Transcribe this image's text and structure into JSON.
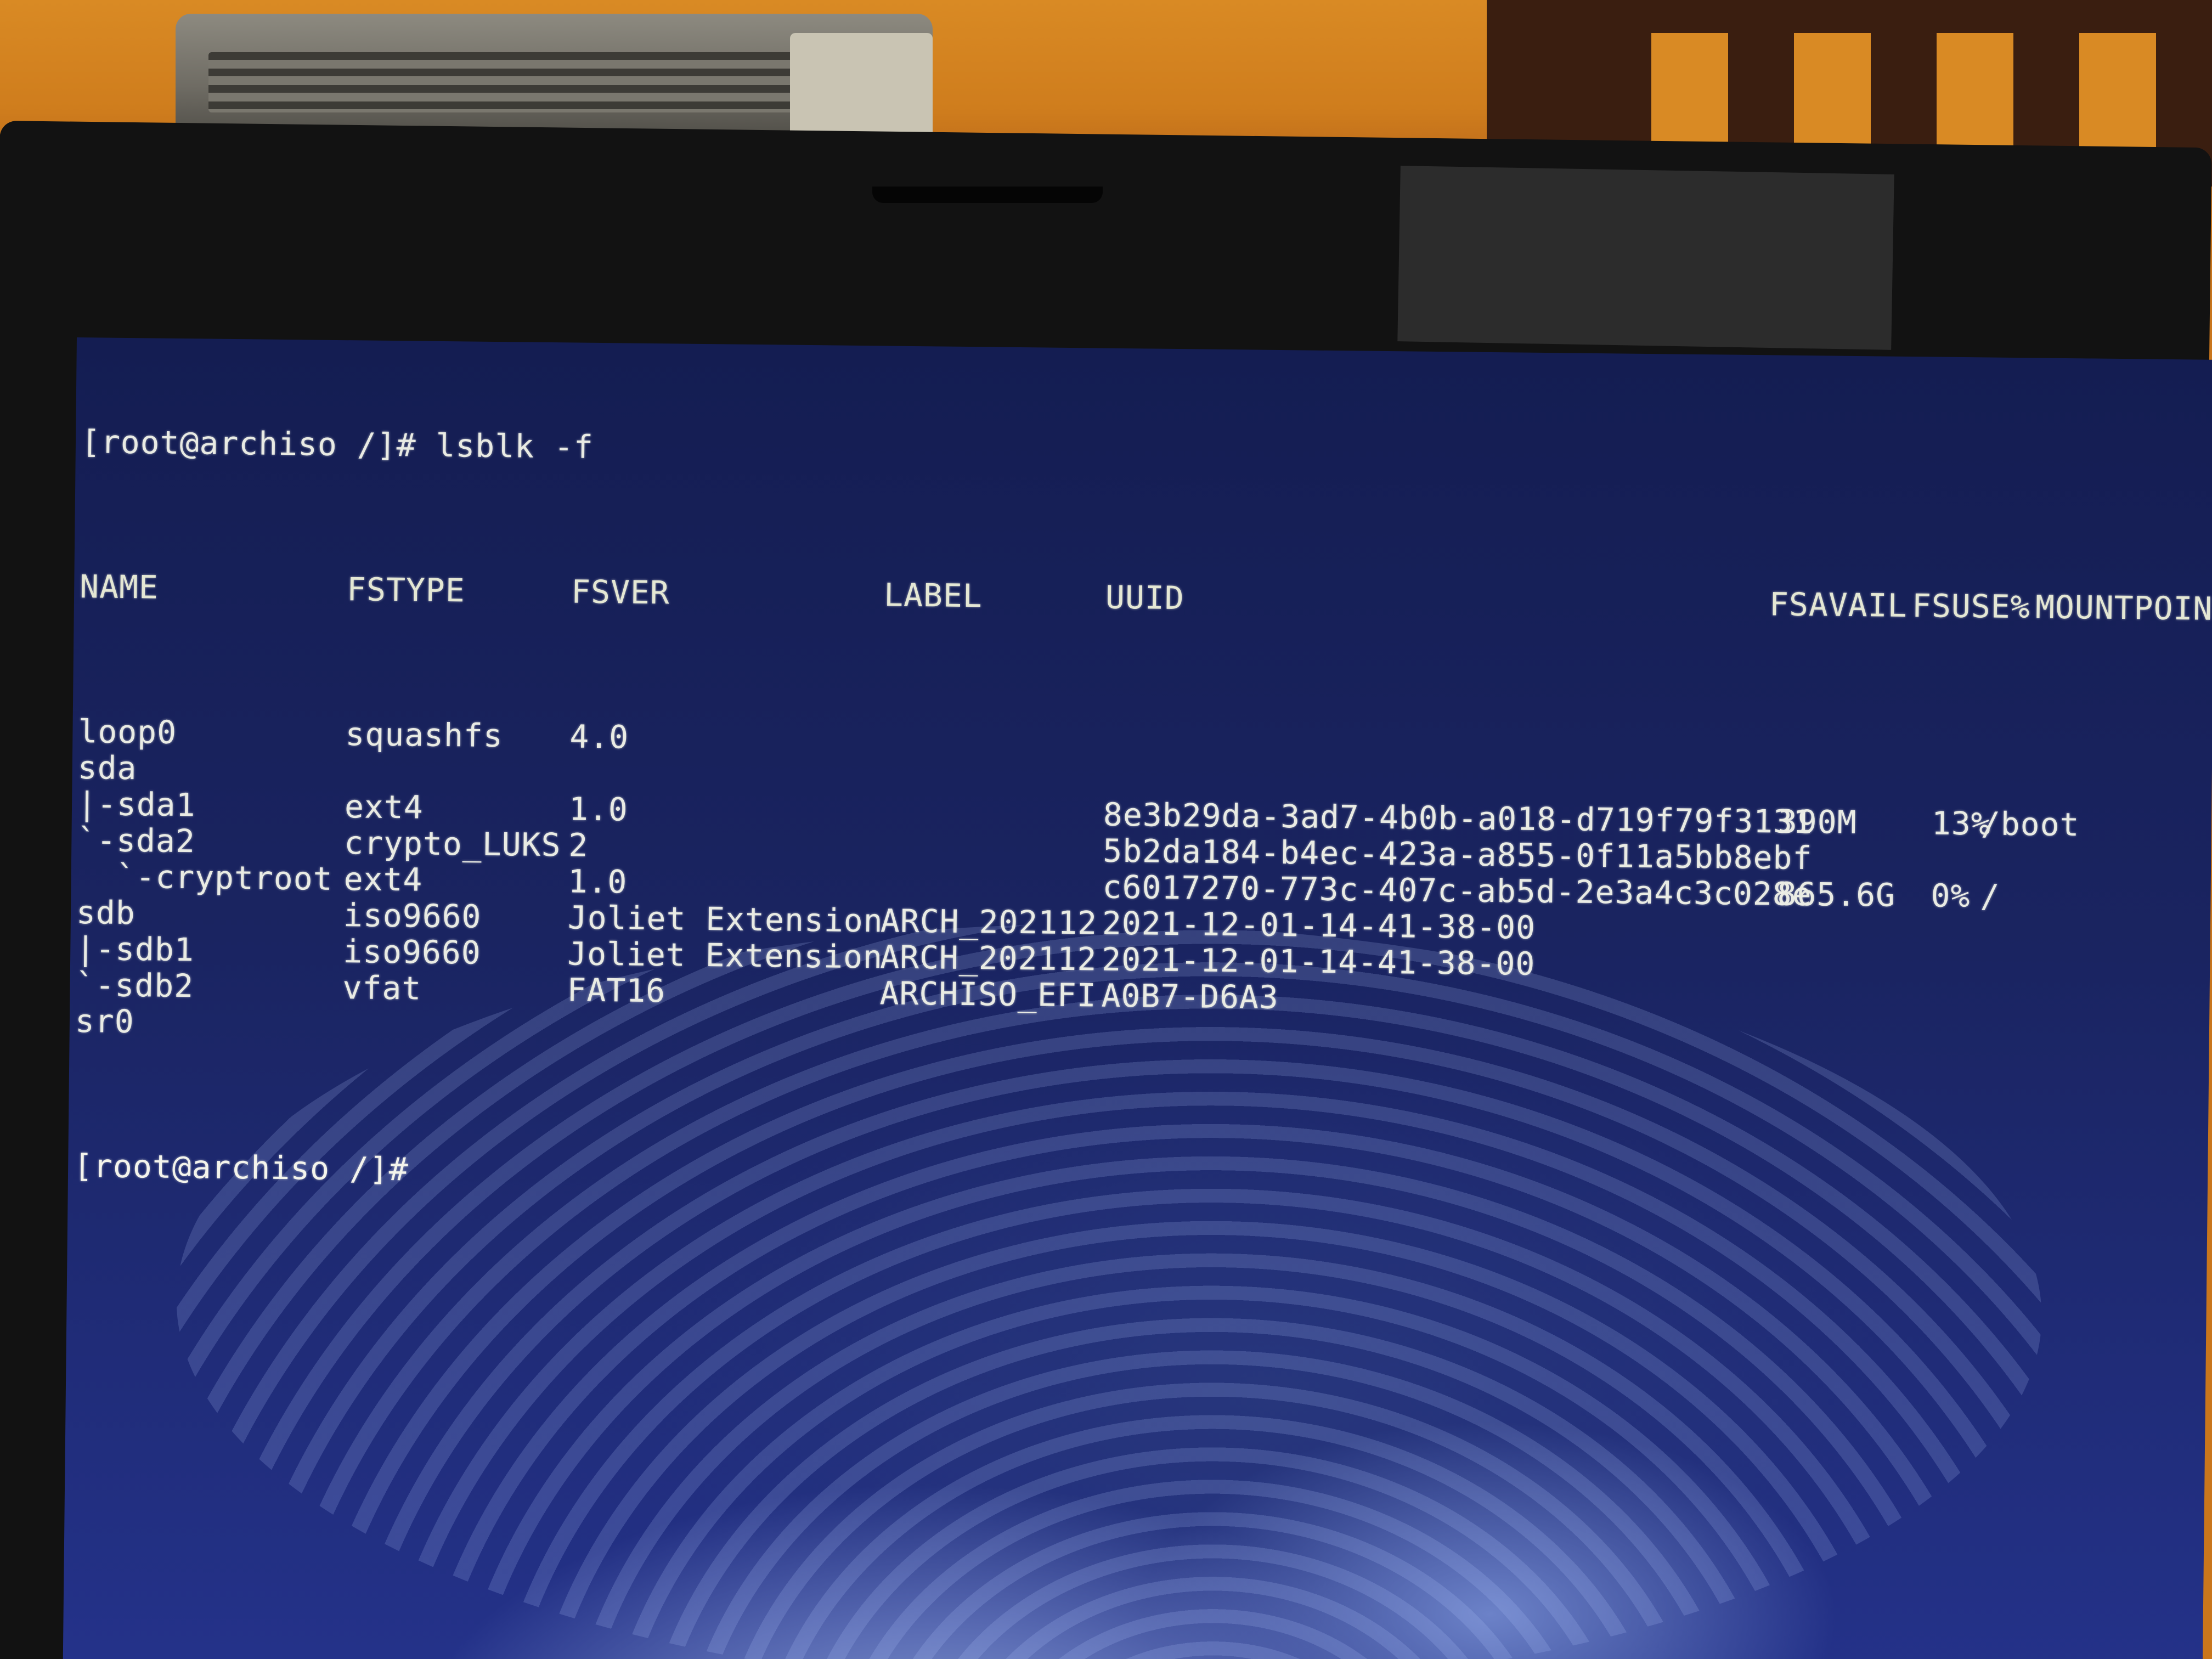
{
  "terminal": {
    "prompt": "[root@archiso /]# lsblk -f",
    "prompt_end": "[root@archiso /]#",
    "headers": {
      "name": "NAME",
      "fstype": "FSTYPE",
      "fsver": "FSVER",
      "label": "LABEL",
      "uuid": "UUID",
      "fsavail": "FSAVAIL",
      "fsuse": "FSUSE%",
      "mountpoint": "MOUNTPOINTS"
    },
    "rows": [
      {
        "name": "loop0",
        "fstype": "squashfs",
        "fsver": "4.0",
        "label": "",
        "uuid": "",
        "fsavail": "",
        "fsuse": "",
        "mount": ""
      },
      {
        "name": "sda",
        "fstype": "",
        "fsver": "",
        "label": "",
        "uuid": "",
        "fsavail": "",
        "fsuse": "",
        "mount": ""
      },
      {
        "name": "|-sda1",
        "fstype": "ext4",
        "fsver": "1.0",
        "label": "",
        "uuid": "8e3b29da-3ad7-4b0b-a018-d719f79f3131",
        "fsavail": "390M",
        "fsuse": "13%",
        "mount": "/boot"
      },
      {
        "name": "`-sda2",
        "fstype": "crypto_LUKS",
        "fsver": "2",
        "label": "",
        "uuid": "5b2da184-b4ec-423a-a855-0f11a5bb8ebf",
        "fsavail": "",
        "fsuse": "",
        "mount": ""
      },
      {
        "name": "  `-cryptroot",
        "fstype": "ext4",
        "fsver": "1.0",
        "label": "",
        "uuid": "c6017270-773c-407c-ab5d-2e3a4c3c028e",
        "fsavail": "865.6G",
        "fsuse": "0%",
        "mount": "/"
      },
      {
        "name": "sdb",
        "fstype": "iso9660",
        "fsver": "Joliet Extension",
        "label": "ARCH_202112",
        "uuid": "2021-12-01-14-41-38-00",
        "fsavail": "",
        "fsuse": "",
        "mount": ""
      },
      {
        "name": "|-sdb1",
        "fstype": "iso9660",
        "fsver": "Joliet Extension",
        "label": "ARCH_202112",
        "uuid": "2021-12-01-14-41-38-00",
        "fsavail": "",
        "fsuse": "",
        "mount": ""
      },
      {
        "name": "`-sdb2",
        "fstype": "vfat",
        "fsver": "FAT16",
        "label": "ARCHISO_EFI",
        "uuid": "A0B7-D6A3",
        "fsavail": "",
        "fsuse": "",
        "mount": ""
      },
      {
        "name": "sr0",
        "fstype": "",
        "fsver": "",
        "label": "",
        "uuid": "",
        "fsavail": "",
        "fsuse": "",
        "mount": ""
      }
    ]
  }
}
